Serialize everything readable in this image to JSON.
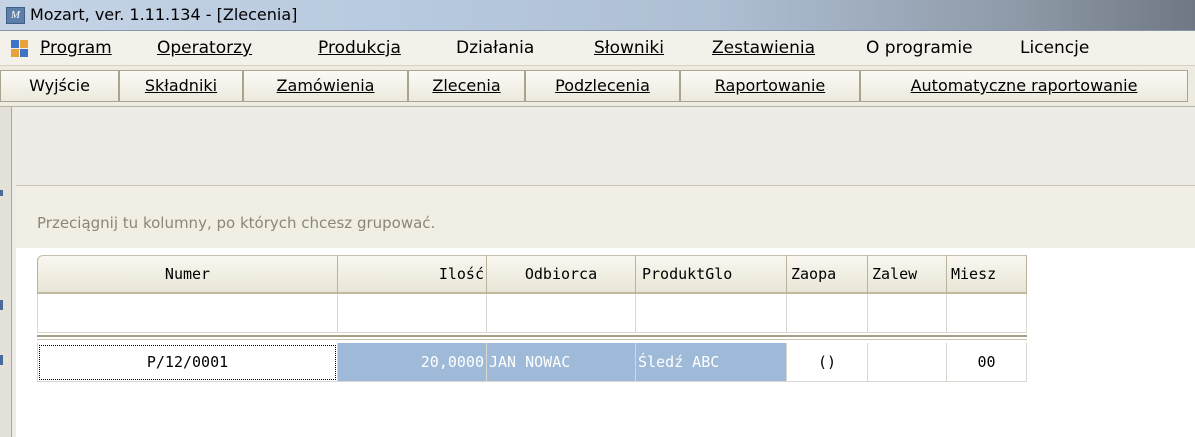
{
  "window": {
    "title": "Mozart, ver. 1.11.134 - [Zlecenia]",
    "icon": "mozart-app-icon"
  },
  "menu": {
    "icon": "mdi-child-icon",
    "items": [
      {
        "label": "Program",
        "underline": "P"
      },
      {
        "label": "Operatorzy",
        "underline": "O"
      },
      {
        "label": "Produkcja",
        "underline": "P"
      },
      {
        "label": "Działania",
        "underline": ""
      },
      {
        "label": "Słowniki",
        "underline": "S"
      },
      {
        "label": "Zestawienia",
        "underline": "Z"
      },
      {
        "label": "O programie",
        "underline": ""
      },
      {
        "label": "Licencje",
        "underline": ""
      }
    ]
  },
  "toolbar": {
    "buttons": [
      {
        "label": "Wyjście"
      },
      {
        "label": "Składniki"
      },
      {
        "label": "Zamówienia"
      },
      {
        "label": "Zlecenia"
      },
      {
        "label": "Podzlecenia"
      },
      {
        "label": "Raportowanie"
      },
      {
        "label": "Automatyczne raportowanie"
      }
    ]
  },
  "grid": {
    "group_hint": "Przeciągnij tu kolumny, po których chcesz grupować.",
    "columns": [
      "Numer",
      "Ilość",
      "Odbiorca",
      "ProduktGlo",
      "Zaopa",
      "Zalew",
      "Miesz"
    ],
    "rows": [
      {
        "numer": "P/12/0001",
        "ilosc": "20,0000",
        "odbiorca": "JAN NOWAC",
        "produkt": "Śledź ABC",
        "zaopa": "()",
        "zalew": "",
        "miesz": "00"
      }
    ]
  },
  "colors": {
    "selection": "#9ebad8",
    "menubar": "#f3f1ea",
    "toolbar": "#eeebe0"
  }
}
